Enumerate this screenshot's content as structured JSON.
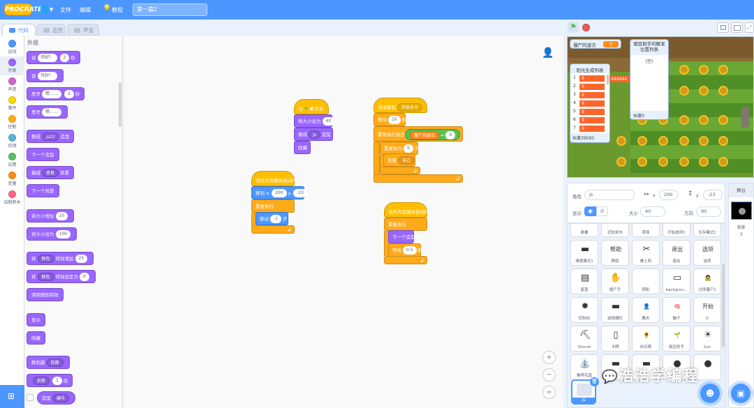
{
  "header": {
    "logo_text": "PROCRATE",
    "menu": {
      "file": "文件",
      "edit": "编辑",
      "tutorial": "教程"
    },
    "project_title": "第一篇2"
  },
  "tabs": {
    "code": "代码",
    "costume": "造型",
    "sound": "声音"
  },
  "categories": [
    {
      "label": "运动",
      "color": "#4c97ff"
    },
    {
      "label": "外观",
      "color": "#9966ff"
    },
    {
      "label": "声音",
      "color": "#cf63cf"
    },
    {
      "label": "事件",
      "color": "#ffd500"
    },
    {
      "label": "控制",
      "color": "#ffab19"
    },
    {
      "label": "侦测",
      "color": "#5cb1d6"
    },
    {
      "label": "运算",
      "color": "#59c059"
    },
    {
      "label": "变量",
      "color": "#ff8c1a"
    },
    {
      "label": "自制积木",
      "color": "#ff6680"
    }
  ],
  "palette": {
    "section_title": "外观",
    "say_for": {
      "text": "说",
      "arg": "你好！",
      "num": "2",
      "unit": "秒"
    },
    "say": {
      "text": "说",
      "arg": "你好！"
    },
    "think_for": {
      "text": "思考",
      "arg": "嗯……",
      "num": "2",
      "unit": "秒"
    },
    "think": {
      "text": "思考",
      "arg": "嗯……"
    },
    "switch_costume": {
      "text": "换成",
      "arg": "js22",
      "suffix": "造型"
    },
    "next_costume": "下一个造型",
    "switch_backdrop": {
      "text": "换成",
      "arg": "背景",
      "suffix": "背景"
    },
    "next_backdrop": "下一个背景",
    "change_size": {
      "text": "将大小增加",
      "num": "10"
    },
    "set_size": {
      "text": "将大小设为",
      "num": "100"
    },
    "change_effect": {
      "text": "将",
      "arg": "颜色",
      "mid": "特效增加",
      "num": "25"
    },
    "set_effect": {
      "text": "将",
      "arg": "颜色",
      "mid": "特效设定为",
      "num": "0"
    },
    "clear_effects": "清除图形特效",
    "show": "显示",
    "hide": "隐藏",
    "go_layer": {
      "text": "移到最",
      "arg": "前面"
    },
    "go_layers": {
      "arg": "前移",
      "num": "1",
      "unit": "层"
    },
    "costume_num": {
      "text": "造型",
      "arg": "编号"
    }
  },
  "scripts": {
    "s1": {
      "hat": "当",
      "hat2": "被点击",
      "set_size": "将大小设为",
      "size": "40",
      "switch": "换成",
      "costume": "js",
      "suffix": "造型",
      "hide": "隐藏"
    },
    "s2": {
      "hat": "当接收到",
      "msg": "开始关卡",
      "wait": "等待",
      "wait_num": "10",
      "wait_unit": "秒",
      "repeat_until": "重复执行直到",
      "var": "僵尸的波次",
      "eq": "=",
      "val": "0",
      "repeat": "重复执行",
      "rep_num": "5",
      "rep_unit": "次",
      "clone": "克隆",
      "clone_arg": "自己"
    },
    "s3": {
      "hat": "当作为克隆体启动时",
      "goto": "移到 x:",
      "x": "200",
      "ylab": "y:",
      "y": "-23",
      "forever": "重复执行",
      "move": "移动",
      "steps": "-1",
      "step_unit": "步"
    },
    "s4": {
      "hat": "当作为克隆体启动时",
      "forever": "重复执行",
      "next": "下一个造型",
      "wait": "等待",
      "wait_num": "0.5",
      "wait_unit": "秒"
    }
  },
  "stage": {
    "wave_label": "僵尸的波次",
    "wave_value": "0",
    "list_title": "阳光生成列表",
    "list_values": [
      "9",
      "9",
      "9",
      "9",
      "9",
      "9",
      "9"
    ],
    "list_idx": [
      "1",
      "2",
      "3",
      "4",
      "5",
      "6",
      "7"
    ],
    "list_length": "长度39593",
    "list_marker": "444444",
    "pea_title": "豌豆射手的解发位置列表",
    "pea_empty": "(空)",
    "pea_length": "长度0"
  },
  "sprite_info": {
    "name_label": "角色",
    "name": "js",
    "x_label": "x",
    "x": "200",
    "y_label": "y",
    "y": "-23",
    "show_label": "显示",
    "size_label": "大小",
    "size": "40",
    "dir_label": "方向",
    "dir": "90"
  },
  "sprites": [
    {
      "name": "鼻覆",
      "icon": "▬"
    },
    {
      "name": "近处树木",
      "icon": "▬"
    },
    {
      "name": "草摔",
      "icon": "▬"
    },
    {
      "name": "开始选项1",
      "icon": "▬"
    },
    {
      "name": "生存模式1",
      "icon": "▬"
    },
    {
      "name": "难度模式1",
      "icon": "▬"
    },
    {
      "name": "帮助",
      "icon": "帮助"
    },
    {
      "name": "推土机",
      "icon": "✂"
    },
    {
      "name": "退出",
      "icon": "退出"
    },
    {
      "name": "选项",
      "icon": "选项"
    },
    {
      "name": "星盖",
      "icon": "▤"
    },
    {
      "name": "僵尸手",
      "icon": "✋"
    },
    {
      "name": "阴影",
      "icon": ""
    },
    {
      "name": "backgrou...",
      "icon": "▭"
    },
    {
      "name": "过场僵尸1",
      "icon": "🧟"
    },
    {
      "name": "控制台",
      "icon": "✹"
    },
    {
      "name": "选择器栏",
      "icon": "▬"
    },
    {
      "name": "戴夫",
      "icon": "👤"
    },
    {
      "name": "脑子",
      "icon": "🧠"
    },
    {
      "name": "0",
      "icon": "开始"
    },
    {
      "name": "Shovel",
      "icon": "⛏"
    },
    {
      "name": "卡牌",
      "icon": "▯"
    },
    {
      "name": "向日葵",
      "icon": "🌻"
    },
    {
      "name": "豌豆射手",
      "icon": "🌱"
    },
    {
      "name": "Sun",
      "icon": "☀"
    },
    {
      "name": "推荐花园",
      "icon": "⛲"
    },
    {
      "name": "",
      "icon": "▬"
    },
    {
      "name": "",
      "icon": "▬"
    },
    {
      "name": "",
      "icon": "●"
    },
    {
      "name": "",
      "icon": "●"
    }
  ],
  "selected_sprite": {
    "name": "js"
  },
  "stage_pane": {
    "title": "舞台",
    "backdrop_label": "背景",
    "backdrop_count": "3"
  },
  "watermark": "浩浩学编程",
  "colors": {
    "accent": "#4c97ff",
    "looks": "#9966ff",
    "events": "#ffbf00",
    "control": "#ffab19",
    "motion": "#4c97ff",
    "operators": "#59c059",
    "variables": "#ff8c1a",
    "list": "#fc662c"
  }
}
